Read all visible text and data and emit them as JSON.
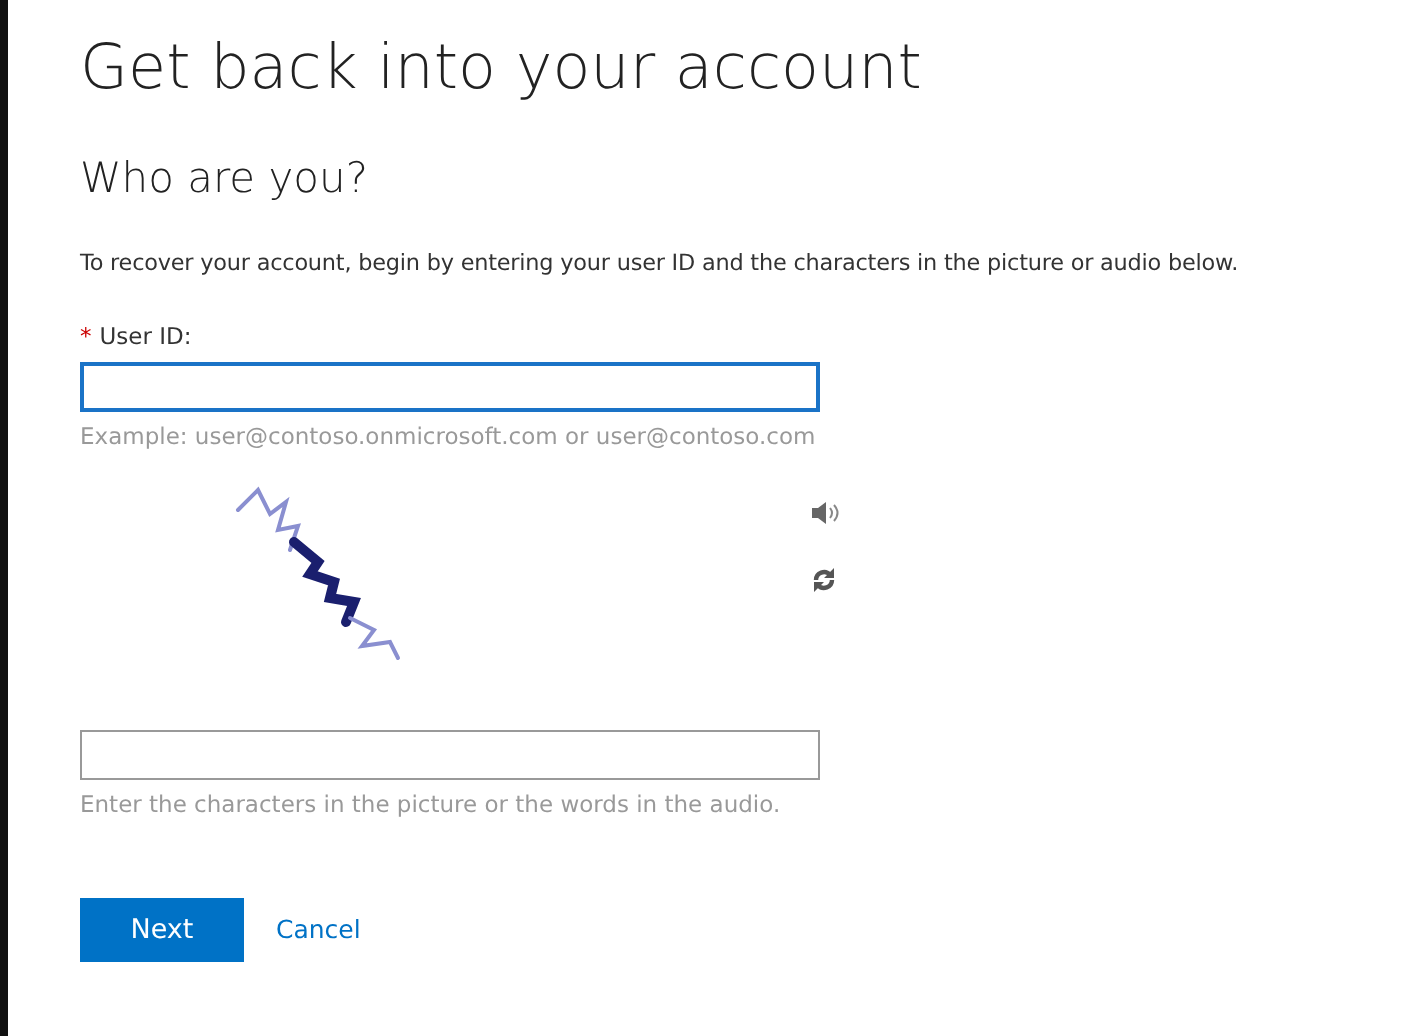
{
  "title": "Get back into your account",
  "subtitle": "Who are you?",
  "intro": "To recover your account, begin by entering your user ID and the characters in the picture or audio below.",
  "user_id": {
    "required_mark": "*",
    "label": "User ID:",
    "focused": true,
    "hint": "Example: user@contoso.onmicrosoft.com or user@contoso.com"
  },
  "captcha": {
    "focused": false,
    "hint": "Enter the characters in the picture or the words in the audio."
  },
  "buttons": [
    {
      "kind": "primary",
      "label": "Next"
    },
    {
      "kind": "link",
      "label": "Cancel"
    }
  ]
}
